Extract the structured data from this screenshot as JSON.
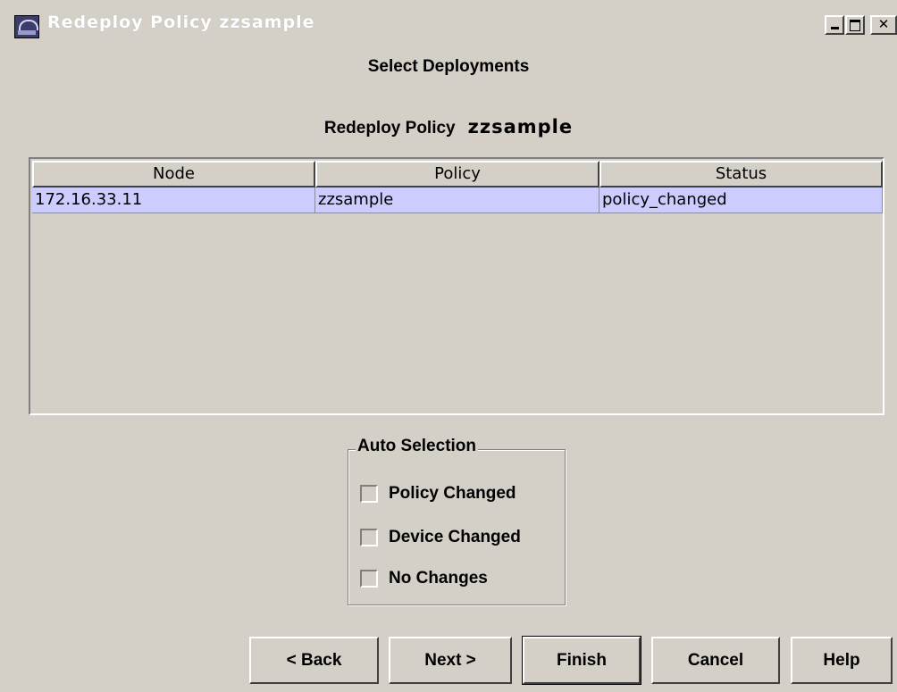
{
  "window": {
    "title": "Redeploy Policy zzsample"
  },
  "page": {
    "heading": "Select Deployments",
    "subheading_label": "Redeploy Policy",
    "subheading_value": "zzsample"
  },
  "table": {
    "columns": [
      "Node",
      "Policy",
      "Status"
    ],
    "rows": [
      {
        "node": "172.16.33.11",
        "policy": "zzsample",
        "status": "policy_changed",
        "selected": true
      }
    ]
  },
  "auto_selection": {
    "title": "Auto Selection",
    "options": [
      {
        "label": "Policy Changed",
        "checked": false
      },
      {
        "label": "Device Changed",
        "checked": false
      },
      {
        "label": "No Changes",
        "checked": false
      }
    ]
  },
  "buttons": {
    "back": "< Back",
    "next": "Next >",
    "finish": "Finish",
    "cancel": "Cancel",
    "help": "Help"
  },
  "colors": {
    "window_bg": "#d4d0c8",
    "selected_row": "#ccccff"
  }
}
